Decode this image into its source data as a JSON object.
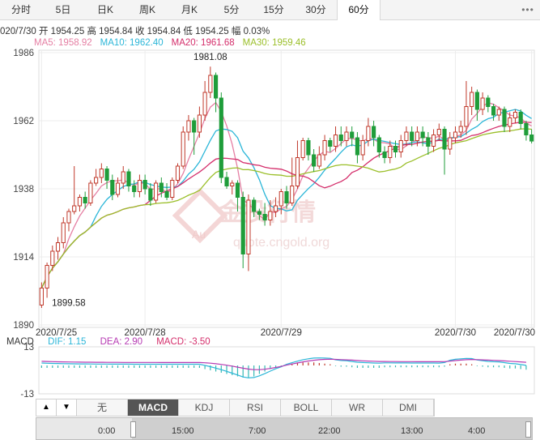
{
  "tabs": [
    "分时",
    "5日",
    "日K",
    "周K",
    "月K",
    "5分",
    "15分",
    "30分",
    "60分"
  ],
  "active_tab": "60分",
  "ohlc": {
    "date": "020/7/30",
    "open_label": "开",
    "open": "1954.25",
    "high_label": "高",
    "high": "1954.84",
    "close_label": "收",
    "close": "1954.84",
    "low_label": "低",
    "low": "1954.25",
    "amp_label": "幅",
    "amp": "0.03%"
  },
  "ma_legend": [
    {
      "label": "MA5: 1958.92",
      "color": "#e57fa3"
    },
    {
      "label": "MA10: 1962.40",
      "color": "#2bb6d8"
    },
    {
      "label": "MA20: 1961.68",
      "color": "#d42e6b"
    },
    {
      "label": "MA30: 1959.46",
      "color": "#9bbf2a"
    }
  ],
  "macd_legend": {
    "title": "MACD",
    "dif": "DIF: 1.15",
    "dea": "DEA: 2.90",
    "macd": "MACD: -3.50",
    "dif_color": "#2bb6d8",
    "dea_color": "#b63ab3",
    "macd_color": "#d42e6b"
  },
  "indicator_buttons": [
    "无",
    "MACD",
    "KDJ",
    "RSI",
    "BOLL",
    "WR",
    "DMI"
  ],
  "active_indicator": "MACD",
  "nav_labels": [
    "0:00",
    "15:00",
    "7:00",
    "22:00",
    "13:00",
    "4:00"
  ],
  "watermark": {
    "text": "金投行情",
    "sub": "quote.cngold.org",
    "logo": "Au"
  },
  "chart_data": {
    "type": "candlestick",
    "price_axis": {
      "ticks": [
        1986,
        1962,
        1938,
        1914,
        1890
      ],
      "ylim": [
        1890,
        1986
      ]
    },
    "macd_axis": {
      "ticks": [
        13,
        -13
      ],
      "ylim": [
        -13,
        13
      ]
    },
    "date_labels": [
      {
        "label": "2020/7/25",
        "index": 0
      },
      {
        "label": "2020/7/28",
        "index": 19
      },
      {
        "label": "2020/7/29",
        "index": 44
      },
      {
        "label": "2020/7/30",
        "index": 76
      },
      {
        "label": "2020/7/30",
        "index": 90
      }
    ],
    "annotations": [
      {
        "text": "1981.08",
        "index": 31,
        "value": 1981.08
      },
      {
        "text": "1899.58",
        "index": 1,
        "value": 1899.58
      }
    ],
    "up_color": "#c0392b",
    "down_color": "#1f9d3a",
    "candles": [
      [
        1897,
        1903,
        1896,
        1905
      ],
      [
        1903,
        1911,
        1899.58,
        1912
      ],
      [
        1911,
        1916,
        1909,
        1918
      ],
      [
        1916,
        1919,
        1913,
        1921
      ],
      [
        1919,
        1926,
        1917,
        1928
      ],
      [
        1926,
        1930,
        1923,
        1931
      ],
      [
        1930,
        1932,
        1929,
        1946
      ],
      [
        1932,
        1935,
        1930,
        1936
      ],
      [
        1935,
        1933,
        1931,
        1937
      ],
      [
        1933,
        1940,
        1932,
        1941
      ],
      [
        1940,
        1942,
        1939,
        1945
      ],
      [
        1942,
        1945,
        1940,
        1947
      ],
      [
        1945,
        1941,
        1938,
        1946
      ],
      [
        1941,
        1936,
        1934,
        1943
      ],
      [
        1936,
        1940,
        1935,
        1942
      ],
      [
        1940,
        1944,
        1938,
        1946
      ],
      [
        1944,
        1939,
        1937,
        1945
      ],
      [
        1939,
        1937,
        1935,
        1941
      ],
      [
        1937,
        1941,
        1935,
        1943
      ],
      [
        1941,
        1938,
        1936,
        1943
      ],
      [
        1938,
        1934,
        1932,
        1940
      ],
      [
        1934,
        1940,
        1933,
        1941
      ],
      [
        1940,
        1937,
        1935,
        1942
      ],
      [
        1937,
        1935,
        1934,
        1940
      ],
      [
        1935,
        1941,
        1934,
        1942
      ],
      [
        1941,
        1946,
        1940,
        1947
      ],
      [
        1946,
        1958,
        1945,
        1960
      ],
      [
        1958,
        1962,
        1955,
        1964
      ],
      [
        1962,
        1958,
        1950,
        1963
      ],
      [
        1958,
        1964,
        1956,
        1967
      ],
      [
        1964,
        1972,
        1962,
        1976
      ],
      [
        1972,
        1978,
        1970,
        1981.08
      ],
      [
        1978,
        1970,
        1965,
        1979
      ],
      [
        1970,
        1942,
        1940,
        1972
      ],
      [
        1942,
        1939,
        1938,
        1944
      ],
      [
        1939,
        1940,
        1936,
        1941
      ],
      [
        1940,
        1935,
        1930,
        1941
      ],
      [
        1935,
        1915,
        1910,
        1937
      ],
      [
        1915,
        1934,
        1909,
        1936
      ],
      [
        1934,
        1930,
        1928,
        1935
      ],
      [
        1930,
        1929,
        1927,
        1931
      ],
      [
        1929,
        1927,
        1925,
        1933
      ],
      [
        1927,
        1930,
        1925,
        1934
      ],
      [
        1930,
        1932,
        1928,
        1935
      ],
      [
        1932,
        1937,
        1929,
        1938
      ],
      [
        1937,
        1933,
        1931,
        1939
      ],
      [
        1933,
        1939,
        1932,
        1949
      ],
      [
        1939,
        1949,
        1938,
        1955
      ],
      [
        1949,
        1955,
        1948,
        1956
      ],
      [
        1955,
        1950,
        1948,
        1956
      ],
      [
        1950,
        1946,
        1944,
        1952
      ],
      [
        1946,
        1950,
        1945,
        1953
      ],
      [
        1950,
        1955,
        1948,
        1957
      ],
      [
        1955,
        1953,
        1951,
        1956
      ],
      [
        1953,
        1957,
        1951,
        1960
      ],
      [
        1957,
        1955,
        1953,
        1960
      ],
      [
        1955,
        1958,
        1953,
        1960
      ],
      [
        1958,
        1956,
        1953,
        1960
      ],
      [
        1956,
        1950,
        1947,
        1958
      ],
      [
        1950,
        1955,
        1948,
        1957
      ],
      [
        1955,
        1960,
        1953,
        1963
      ],
      [
        1960,
        1956,
        1953,
        1962
      ],
      [
        1956,
        1951,
        1949,
        1957
      ],
      [
        1951,
        1949,
        1947,
        1953
      ],
      [
        1949,
        1953,
        1947,
        1955
      ],
      [
        1953,
        1951,
        1949,
        1955
      ],
      [
        1951,
        1955,
        1949,
        1957
      ],
      [
        1955,
        1958,
        1953,
        1960
      ],
      [
        1958,
        1955,
        1953,
        1960
      ],
      [
        1955,
        1958,
        1953,
        1960
      ],
      [
        1958,
        1956,
        1953,
        1960
      ],
      [
        1956,
        1953,
        1950,
        1958
      ],
      [
        1953,
        1957,
        1951,
        1959
      ],
      [
        1957,
        1959,
        1955,
        1961
      ],
      [
        1959,
        1952,
        1943,
        1960
      ],
      [
        1952,
        1956,
        1950,
        1958
      ],
      [
        1956,
        1958,
        1954,
        1960
      ],
      [
        1958,
        1960,
        1956,
        1962
      ],
      [
        1960,
        1967,
        1957,
        1976
      ],
      [
        1967,
        1972,
        1964,
        1974
      ],
      [
        1972,
        1966,
        1962,
        1973
      ],
      [
        1966,
        1970,
        1964,
        1972
      ],
      [
        1970,
        1967,
        1965,
        1971
      ],
      [
        1967,
        1964,
        1962,
        1968
      ],
      [
        1964,
        1966,
        1962,
        1967
      ],
      [
        1966,
        1960,
        1958,
        1967
      ],
      [
        1960,
        1963,
        1958,
        1965
      ],
      [
        1963,
        1965,
        1961,
        1966
      ],
      [
        1965,
        1961,
        1959,
        1966
      ],
      [
        1961,
        1957,
        1955,
        1962
      ],
      [
        1957,
        1954.84,
        1954,
        1959
      ]
    ],
    "macd_histogram": [
      -2,
      -2,
      -2,
      -2,
      -2,
      -2,
      -2,
      -2,
      -2,
      -2,
      -2,
      -2,
      -2,
      -2,
      -2,
      -2,
      -2,
      -2,
      -2,
      -2,
      -2,
      -2,
      -2,
      -2,
      -2,
      -2,
      -2,
      -2,
      -2,
      -2,
      -3,
      -4,
      -5,
      -6,
      -7,
      -8,
      -9,
      -10,
      -10,
      -9,
      -7,
      -5,
      -3,
      -1.5,
      -0.5,
      1,
      1.5,
      2,
      2.5,
      2.5,
      2.5,
      2,
      1.5,
      1,
      -0.5,
      -1,
      -1,
      -1.5,
      -2,
      -2,
      -2,
      -2,
      -2,
      -1.5,
      -1.5,
      -1.5,
      -1.5,
      -1.5,
      -1.5,
      -1.5,
      -1.5,
      -1.5,
      -1.5,
      -1.5,
      -1,
      1,
      1.5,
      1.5,
      1.5,
      1,
      -0.5,
      -1,
      -1.5,
      -1.5,
      -1.5,
      -2,
      -2.5,
      -2.5,
      -3,
      -3.5
    ]
  }
}
